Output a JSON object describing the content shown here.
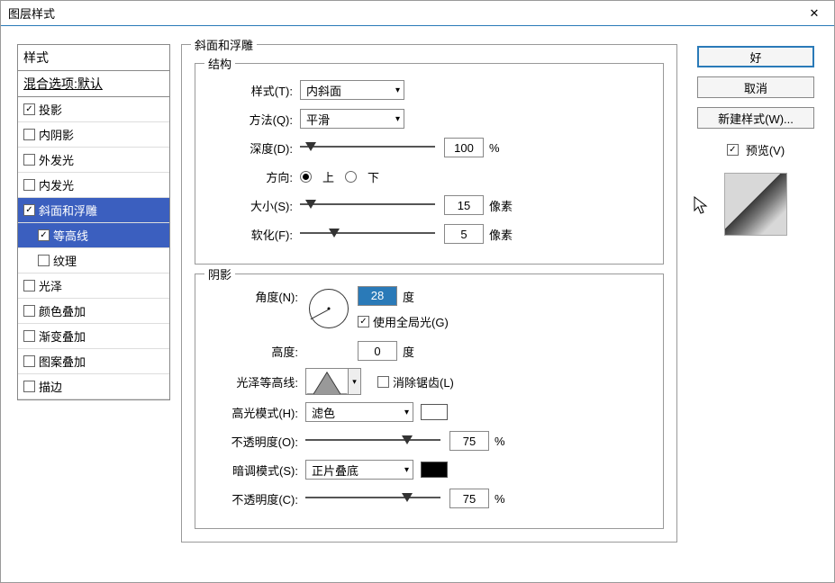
{
  "window": {
    "title": "图层样式",
    "close": "✕"
  },
  "left": {
    "styles_header": "样式",
    "blend_header": "混合选项:默认",
    "items": [
      {
        "label": "投影",
        "checked": true
      },
      {
        "label": "内阴影",
        "checked": false
      },
      {
        "label": "外发光",
        "checked": false
      },
      {
        "label": "内发光",
        "checked": false
      },
      {
        "label": "斜面和浮雕",
        "checked": true,
        "selected": true
      },
      {
        "label": "等高线",
        "checked": true,
        "sub": true
      },
      {
        "label": "纹理",
        "checked": false,
        "sub": true
      },
      {
        "label": "光泽",
        "checked": false
      },
      {
        "label": "颜色叠加",
        "checked": false
      },
      {
        "label": "渐变叠加",
        "checked": false
      },
      {
        "label": "图案叠加",
        "checked": false
      },
      {
        "label": "描边",
        "checked": false
      }
    ]
  },
  "bevel": {
    "title": "斜面和浮雕",
    "structure_title": "结构",
    "style_label": "样式(T):",
    "style_value": "内斜面",
    "technique_label": "方法(Q):",
    "technique_value": "平滑",
    "depth_label": "深度(D):",
    "depth_value": "100",
    "depth_unit": "%",
    "direction_label": "方向:",
    "dir_up": "上",
    "dir_down": "下",
    "size_label": "大小(S):",
    "size_value": "15",
    "size_unit": "像素",
    "soften_label": "软化(F):",
    "soften_value": "5",
    "soften_unit": "像素"
  },
  "shadow": {
    "title": "阴影",
    "angle_label": "角度(N):",
    "angle_value": "28",
    "angle_unit": "度",
    "global_label": "使用全局光(G)",
    "altitude_label": "高度:",
    "altitude_value": "0",
    "altitude_unit": "度",
    "gloss_label": "光泽等高线:",
    "anti_alias": "消除锯齿(L)",
    "highlight_mode_label": "高光模式(H):",
    "highlight_mode_value": "滤色",
    "highlight_color": "#ffffff",
    "highlight_opacity_label": "不透明度(O):",
    "highlight_opacity_value": "75",
    "hi_unit": "%",
    "shadow_mode_label": "暗调模式(S):",
    "shadow_mode_value": "正片叠底",
    "shadow_color": "#000000",
    "shadow_opacity_label": "不透明度(C):",
    "shadow_opacity_value": "75",
    "sh_unit": "%"
  },
  "right": {
    "ok": "好",
    "cancel": "取消",
    "new_style": "新建样式(W)...",
    "preview": "预览(V)"
  }
}
